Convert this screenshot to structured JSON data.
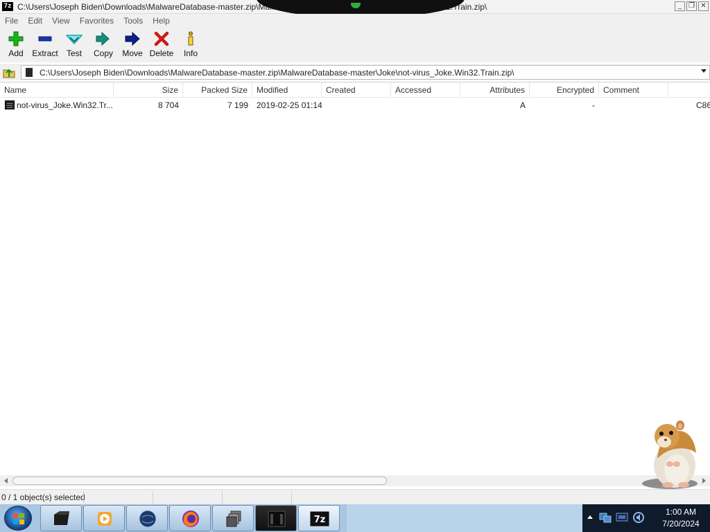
{
  "window": {
    "app_icon_label": "7z",
    "title_left": "C:\\Users\\Joseph Biden\\Downloads\\MalwareDatabase-master.zip\\Ma...",
    "title_right": "...n32.Train.zip\\",
    "buttons": {
      "minimize": "_",
      "restore": "❐",
      "close": "✕"
    }
  },
  "menu": [
    "File",
    "Edit",
    "View",
    "Favorites",
    "Tools",
    "Help"
  ],
  "toolbar": [
    {
      "label": "Add",
      "icon": "plus-icon",
      "color": "#18b418"
    },
    {
      "label": "Extract",
      "icon": "minus-icon",
      "color": "#1a33b0"
    },
    {
      "label": "Test",
      "icon": "check-icon",
      "color": "#1aa3a8"
    },
    {
      "label": "Copy",
      "icon": "double-arrow-icon",
      "color": "#12907a"
    },
    {
      "label": "Move",
      "icon": "arrow-right-icon",
      "color": "#0e1f8a"
    },
    {
      "label": "Delete",
      "icon": "x-icon",
      "color": "#d01818"
    },
    {
      "label": "Info",
      "icon": "info-icon",
      "color": "#c8a300"
    }
  ],
  "address": {
    "path": "C:\\Users\\Joseph Biden\\Downloads\\MalwareDatabase-master.zip\\MalwareDatabase-master\\Joke\\not-virus_Joke.Win32.Train.zip\\"
  },
  "columns": [
    "Name",
    "Size",
    "Packed Size",
    "Modified",
    "Created",
    "Accessed",
    "Attributes",
    "Encrypted",
    "Comment"
  ],
  "rows": [
    {
      "name": "not-virus_Joke.Win32.Tr...",
      "size": "8 704",
      "packed_size": "7 199",
      "modified": "2019-02-25 01:14",
      "created": "",
      "accessed": "",
      "attributes": "A",
      "encrypted": "-",
      "comment": "",
      "overflow": "C86"
    }
  ],
  "status": {
    "selection": "0 / 1 object(s) selected"
  },
  "taskbar": {
    "apps": [
      "terminal-icon",
      "media-player-icon",
      "browser-globe-icon",
      "firefox-icon",
      "window-stack-icon",
      "monitor-icon",
      "7zip-icon"
    ],
    "clock_time": "1:00 AM",
    "clock_date": "7/20/2024"
  }
}
